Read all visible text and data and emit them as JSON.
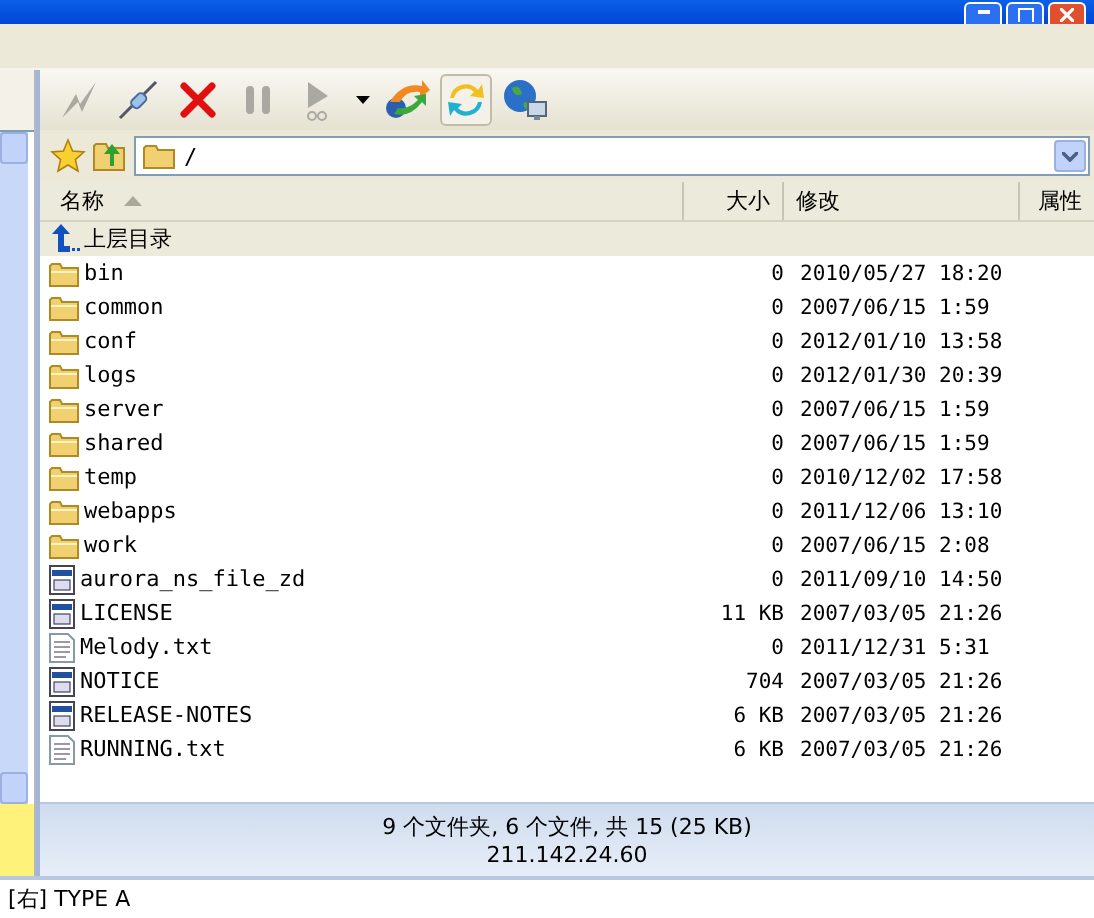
{
  "toolbar": [
    {
      "kind": "lightning",
      "disabled": true,
      "pressed": false
    },
    {
      "kind": "plug",
      "disabled": false,
      "pressed": false
    },
    {
      "kind": "cross",
      "disabled": false,
      "pressed": false
    },
    {
      "kind": "pause",
      "disabled": true,
      "pressed": false
    },
    {
      "kind": "play",
      "disabled": true,
      "pressed": false
    },
    {
      "kind": "caret",
      "disabled": false,
      "pressed": false
    },
    {
      "kind": "transfer",
      "disabled": false,
      "pressed": false
    },
    {
      "kind": "refresh",
      "disabled": false,
      "pressed": true
    },
    {
      "kind": "globe",
      "disabled": false,
      "pressed": false
    }
  ],
  "address": {
    "value": "/"
  },
  "columns": [
    "名称",
    "大小",
    "修改",
    "属性"
  ],
  "rows": [
    {
      "kind": "parent",
      "name": "上层目录",
      "size": "",
      "modified": ""
    },
    {
      "kind": "folder",
      "name": "bin",
      "size": "0",
      "modified": "2010/05/27 18:20"
    },
    {
      "kind": "folder",
      "name": "common",
      "size": "0",
      "modified": "2007/06/15 1:59"
    },
    {
      "kind": "folder",
      "name": "conf",
      "size": "0",
      "modified": "2012/01/10 13:58"
    },
    {
      "kind": "folder",
      "name": "logs",
      "size": "0",
      "modified": "2012/01/30 20:39"
    },
    {
      "kind": "folder",
      "name": "server",
      "size": "0",
      "modified": "2007/06/15 1:59"
    },
    {
      "kind": "folder",
      "name": "shared",
      "size": "0",
      "modified": "2007/06/15 1:59"
    },
    {
      "kind": "folder",
      "name": "temp",
      "size": "0",
      "modified": "2010/12/02 17:58"
    },
    {
      "kind": "folder",
      "name": "webapps",
      "size": "0",
      "modified": "2011/12/06 13:10"
    },
    {
      "kind": "folder",
      "name": "work",
      "size": "0",
      "modified": "2007/06/15 2:08"
    },
    {
      "kind": "file",
      "name": "aurora_ns_file_zd",
      "size": "0",
      "modified": "2011/09/10 14:50"
    },
    {
      "kind": "file",
      "name": "LICENSE",
      "size": "11 KB",
      "modified": "2007/03/05 21:26"
    },
    {
      "kind": "text",
      "name": "Melody.txt",
      "size": "0",
      "modified": "2011/12/31 5:31"
    },
    {
      "kind": "file",
      "name": "NOTICE",
      "size": "704",
      "modified": "2007/03/05 21:26"
    },
    {
      "kind": "file",
      "name": "RELEASE-NOTES",
      "size": "6 KB",
      "modified": "2007/03/05 21:26"
    },
    {
      "kind": "text",
      "name": "RUNNING.txt",
      "size": "6 KB",
      "modified": "2007/03/05 21:26"
    }
  ],
  "status": {
    "summary": "9 个文件夹, 6 个文件, 共 15 (25 KB)",
    "host": "211.142.24.60"
  },
  "log": "[右] TYPE A"
}
